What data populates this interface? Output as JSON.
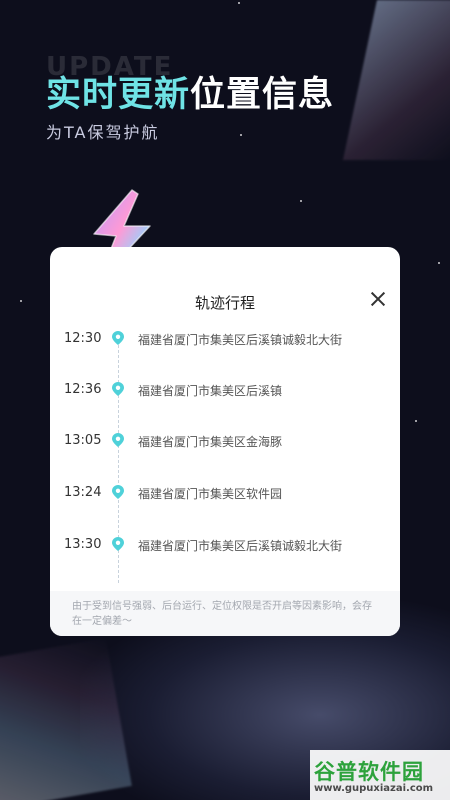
{
  "hero": {
    "ghost_word": "UPDATE",
    "headline_accent": "实时更新",
    "headline_rest": "位置信息",
    "subhead": "为TA保驾护航"
  },
  "colors": {
    "accent": "#6fe3e6",
    "background": "#0d0e1c",
    "pin": "#4fd1d9"
  },
  "card": {
    "title": "轨迹行程",
    "close_icon": "close-icon",
    "timeline": [
      {
        "time": "12:30",
        "address": "福建省厦门市集美区后溪镇诚毅北大街"
      },
      {
        "time": "12:36",
        "address": "福建省厦门市集美区后溪镇"
      },
      {
        "time": "13:05",
        "address": "福建省厦门市集美区金海豚"
      },
      {
        "time": "13:24",
        "address": "福建省厦门市集美区软件园"
      },
      {
        "time": "13:30",
        "address": "福建省厦门市集美区后溪镇诚毅北大街"
      }
    ],
    "note": "由于受到信号强弱、后台运行、定位权限是否开启等因素影响，会存在一定偏差～"
  },
  "watermark": {
    "logo": "谷普软件园",
    "url": "www.gupuxiazai.com"
  }
}
